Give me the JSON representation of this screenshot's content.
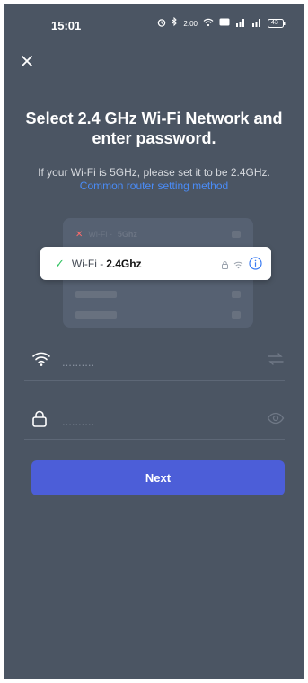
{
  "status_bar": {
    "time": "15:01",
    "icons": [
      "alarm-icon",
      "bluetooth-icon",
      "data-speed-icon",
      "wifi-status-icon",
      "volte-icon",
      "signal-icon",
      "signal-icon",
      "battery-icon"
    ],
    "speed": "2.00",
    "battery": "43"
  },
  "header": {
    "title": "Select 2.4 GHz Wi-Fi Network and enter password.",
    "subtitle": "If your Wi-Fi is 5GHz, please set it to be 2.4GHz.",
    "link": "Common router setting method"
  },
  "illustration": {
    "wrong_label": "Wi-Fi -",
    "wrong_band": "5Ghz",
    "right_label": "Wi-Fi -",
    "right_band": "2.4Ghz"
  },
  "form": {
    "ssid_placeholder": "..........",
    "password_placeholder": ".........."
  },
  "actions": {
    "next_label": "Next"
  },
  "colors": {
    "background": "#4b5563",
    "accent": "#4c5ed8",
    "link": "#4a8cf7",
    "check": "#2ec25f",
    "info": "#3a7bf2"
  }
}
